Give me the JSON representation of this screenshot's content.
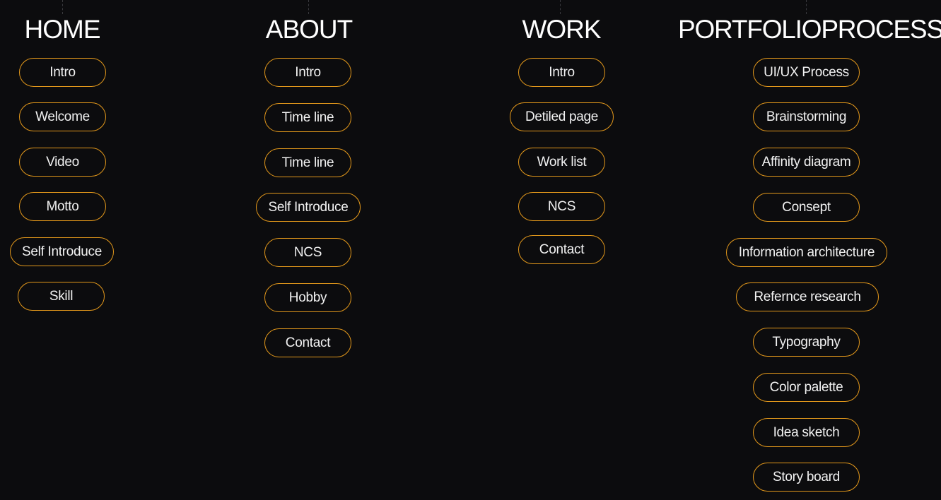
{
  "sections": {
    "home": {
      "title": "HOME",
      "items": [
        "Intro",
        "Welcome",
        "Video",
        "Motto",
        "Self Introduce",
        "Skill"
      ]
    },
    "about": {
      "title": "ABOUT",
      "items": [
        "Intro",
        "Time line",
        "Time line",
        "Self Introduce",
        "NCS",
        "Hobby",
        "Contact"
      ]
    },
    "work": {
      "title": "WORK",
      "items": [
        "Intro",
        "Detiled page",
        "Work list",
        "NCS",
        "Contact"
      ]
    },
    "process": {
      "title": "PORTFOLIOPROCESS",
      "items": [
        "UI/UX Process",
        "Brainstorming",
        "Affinity diagram",
        "Consept",
        "Information architecture",
        "Refernce research",
        "Typography",
        "Color palette",
        "Idea sketch",
        "Story board"
      ]
    }
  },
  "colors": {
    "background": "#0c0c0e",
    "pill_border": "#e3981b",
    "text": "#ffffff"
  }
}
